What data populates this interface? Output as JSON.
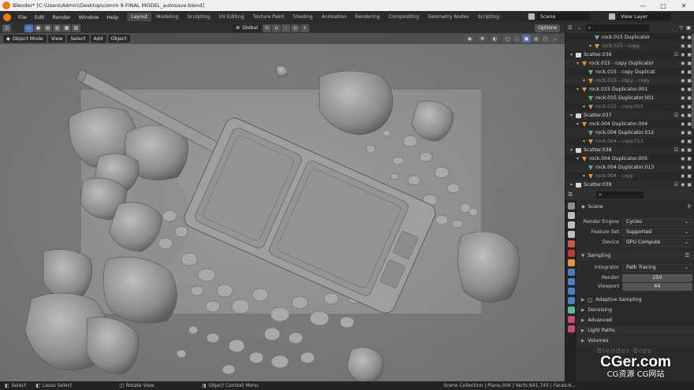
{
  "window": {
    "title": "Blender* [C:\\Users\\Admin\\Desktop\\comm 9-FINAL MODEL_autosave.blend]",
    "controls": [
      "—",
      "▢",
      "✕"
    ]
  },
  "menu": [
    "File",
    "Edit",
    "Render",
    "Window",
    "Help"
  ],
  "workspaces": {
    "active": "Layout",
    "tabs": [
      "Layout",
      "Modeling",
      "Sculpting",
      "UV Editing",
      "Texture Paint",
      "Shading",
      "Animation",
      "Rendering",
      "Compositing",
      "Geometry Nodes",
      "Scripting"
    ]
  },
  "scene_field": "Scene",
  "view_layer_field": "View Layer",
  "viewport_header": {
    "transform_orientation": "Global",
    "options_label": "Options",
    "mode": "Object Mode",
    "menus": [
      "View",
      "Select",
      "Add",
      "Object"
    ]
  },
  "outliner": {
    "rows": [
      {
        "indent": 3,
        "kind": "green",
        "label": "rock.015 Duplicator",
        "dim": false
      },
      {
        "indent": 3,
        "kind": "orange",
        "label": "rock.015 - copy",
        "dim": true
      },
      {
        "indent": 0,
        "kind": "collection",
        "label": "Scatter.036",
        "dim": false
      },
      {
        "indent": 1,
        "kind": "orange",
        "label": "rock.015 - copy Duplicator",
        "dim": false
      },
      {
        "indent": 2,
        "kind": "green",
        "label": "rock.015 - copy Duplicat",
        "dim": false
      },
      {
        "indent": 2,
        "kind": "orange",
        "label": "rock.015 - copy - copy",
        "dim": true
      },
      {
        "indent": 1,
        "kind": "orange",
        "label": "rock.015 Duplicator.001",
        "dim": false
      },
      {
        "indent": 2,
        "kind": "green",
        "label": "rock.015 Duplicator.001",
        "dim": false
      },
      {
        "indent": 2,
        "kind": "orange",
        "label": "rock.015 - copy.001",
        "dim": true
      },
      {
        "indent": 0,
        "kind": "collection",
        "label": "Scatter.037",
        "dim": false
      },
      {
        "indent": 1,
        "kind": "orange",
        "label": "rock.004 Duplicator.004",
        "dim": false
      },
      {
        "indent": 2,
        "kind": "green",
        "label": "rock.004 Duplicator.012",
        "dim": false
      },
      {
        "indent": 2,
        "kind": "orange",
        "label": "rock.004 - copy.013",
        "dim": true
      },
      {
        "indent": 0,
        "kind": "collection",
        "label": "Scatter.038",
        "dim": false
      },
      {
        "indent": 1,
        "kind": "orange",
        "label": "rock.004 Duplicator.005",
        "dim": false
      },
      {
        "indent": 2,
        "kind": "green",
        "label": "rock.004 Duplicator.013",
        "dim": false
      },
      {
        "indent": 2,
        "kind": "orange",
        "label": "rock.004 - copy",
        "dim": true
      },
      {
        "indent": 0,
        "kind": "collection",
        "label": "Scatter.039",
        "dim": false
      }
    ]
  },
  "properties": {
    "context": "Scene",
    "render_engine_label": "Render Engine",
    "render_engine": "Cycles",
    "feature_set_label": "Feature Set",
    "feature_set": "Supported",
    "device_label": "Device",
    "device": "GPU Compute",
    "sampling_label": "Sampling",
    "integrator_label": "Integrator",
    "integrator": "Path Tracing",
    "render_label": "Render",
    "render_samples": "250",
    "viewport_label": "Viewport",
    "viewport_samples": "64",
    "adaptive_sampling": "Adaptive Sampling",
    "denoising": "Denoising",
    "advanced": "Advanced",
    "light_paths": "Light Paths",
    "volumes": "Volumes"
  },
  "watermarks": {
    "blender_bros": "Blender Bros",
    "site": "CGer.com",
    "site_cn": "CG资源 CG网站"
  },
  "statusbar": {
    "select": "Select",
    "lasso": "Lasso Select",
    "rotate": "Rotate View",
    "context_menu": "Object Context Menu",
    "stats": "Scene Collection | Plane.006 | Verts:641,745 | Faces:6..."
  },
  "colors": {
    "accent": "#4772b3",
    "object_orange": "#e8913a",
    "modifier_green": "#5fb38a",
    "viewport_bg": "#8e8e8e"
  }
}
